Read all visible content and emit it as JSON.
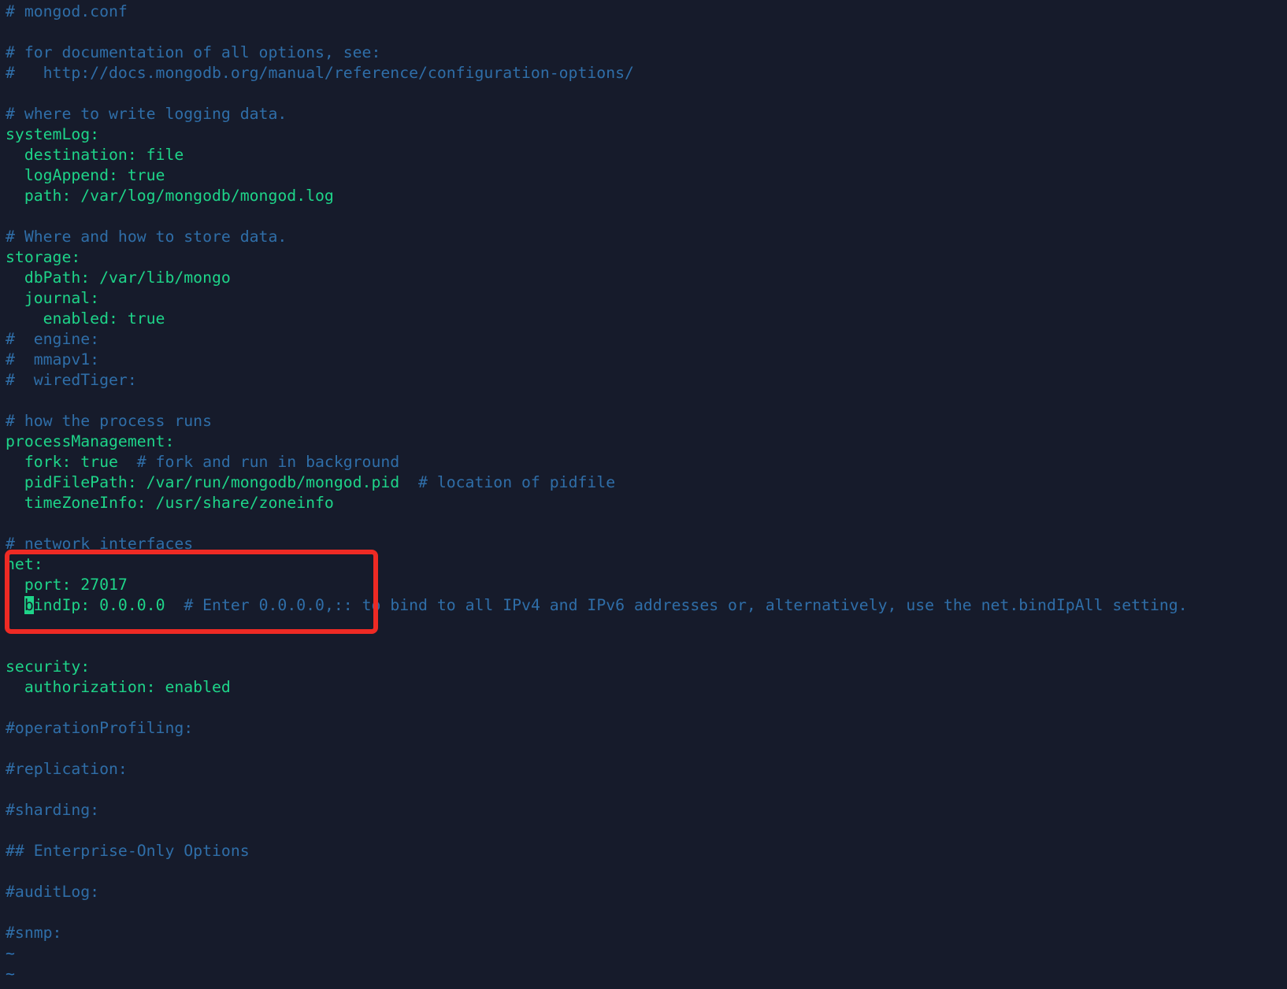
{
  "file_name": "mongod.conf",
  "colors": {
    "background": "#161b2b",
    "comment": "#2f6ea8",
    "code": "#1ed489",
    "tilde": "#2e74b5",
    "highlight_box": "#ee2a24"
  },
  "lines": [
    {
      "kind": "comment",
      "text": "# mongod.conf"
    },
    {
      "kind": "blank",
      "text": ""
    },
    {
      "kind": "comment",
      "text": "# for documentation of all options, see:"
    },
    {
      "kind": "comment",
      "text": "#   http://docs.mongodb.org/manual/reference/configuration-options/"
    },
    {
      "kind": "blank",
      "text": ""
    },
    {
      "kind": "comment",
      "text": "# where to write logging data."
    },
    {
      "kind": "code",
      "text": "systemLog:"
    },
    {
      "kind": "code",
      "text": "  destination: file"
    },
    {
      "kind": "code",
      "text": "  logAppend: true"
    },
    {
      "kind": "code",
      "text": "  path: /var/log/mongodb/mongod.log"
    },
    {
      "kind": "blank",
      "text": ""
    },
    {
      "kind": "comment",
      "text": "# Where and how to store data."
    },
    {
      "kind": "code",
      "text": "storage:"
    },
    {
      "kind": "code",
      "text": "  dbPath: /var/lib/mongo"
    },
    {
      "kind": "code",
      "text": "  journal:"
    },
    {
      "kind": "code",
      "text": "    enabled: true"
    },
    {
      "kind": "comment",
      "text": "#  engine:"
    },
    {
      "kind": "comment",
      "text": "#  mmapv1:"
    },
    {
      "kind": "comment",
      "text": "#  wiredTiger:"
    },
    {
      "kind": "blank",
      "text": ""
    },
    {
      "kind": "comment",
      "text": "# how the process runs"
    },
    {
      "kind": "code",
      "text": "processManagement:"
    },
    {
      "kind": "mixed",
      "code": "  fork: true  ",
      "comment": "# fork and run in background"
    },
    {
      "kind": "mixed",
      "code": "  pidFilePath: /var/run/mongodb/mongod.pid  ",
      "comment": "# location of pidfile"
    },
    {
      "kind": "code",
      "text": "  timeZoneInfo: /usr/share/zoneinfo"
    },
    {
      "kind": "blank",
      "text": ""
    },
    {
      "kind": "comment",
      "text": "# network interfaces"
    },
    {
      "kind": "code",
      "text": "net:"
    },
    {
      "kind": "code",
      "text": "  port: 27017"
    },
    {
      "kind": "cursor-line",
      "pre": "  ",
      "cursor": "b",
      "code": "indIp: 0.0.0.0  ",
      "comment": "# Enter 0.0.0.0,:: to bind to all IPv4 and IPv6 addresses or, alternatively, use the net.bindIpAll setting."
    },
    {
      "kind": "blank",
      "text": ""
    },
    {
      "kind": "blank",
      "text": ""
    },
    {
      "kind": "code",
      "text": "security:"
    },
    {
      "kind": "code",
      "text": "  authorization: enabled"
    },
    {
      "kind": "blank",
      "text": ""
    },
    {
      "kind": "comment",
      "text": "#operationProfiling:"
    },
    {
      "kind": "blank",
      "text": ""
    },
    {
      "kind": "comment",
      "text": "#replication:"
    },
    {
      "kind": "blank",
      "text": ""
    },
    {
      "kind": "comment",
      "text": "#sharding:"
    },
    {
      "kind": "blank",
      "text": ""
    },
    {
      "kind": "comment",
      "text": "## Enterprise-Only Options"
    },
    {
      "kind": "blank",
      "text": ""
    },
    {
      "kind": "comment",
      "text": "#auditLog:"
    },
    {
      "kind": "blank",
      "text": ""
    },
    {
      "kind": "comment",
      "text": "#snmp:"
    },
    {
      "kind": "tilde",
      "text": "~"
    },
    {
      "kind": "tilde",
      "text": "~"
    }
  ]
}
